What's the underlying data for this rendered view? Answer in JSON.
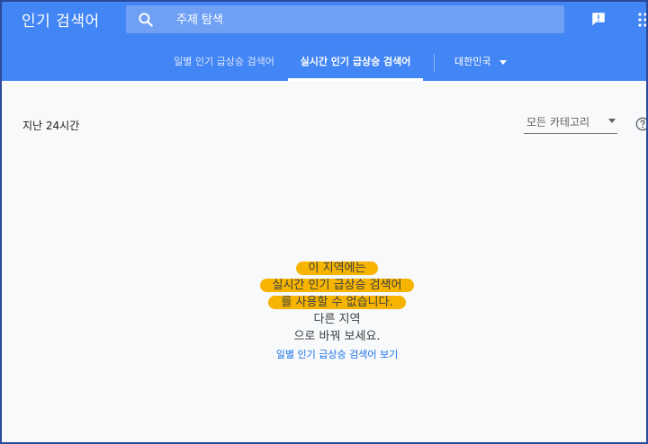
{
  "header": {
    "title": "인기 검색어",
    "search_placeholder": "주제 탐색"
  },
  "tabs": [
    {
      "label": "일별 인기 급상승 검색어"
    },
    {
      "label": "실시간 인기 급상승 검색어",
      "active": true
    }
  ],
  "country": {
    "label": "대한민국"
  },
  "filters": {
    "period": "지난 24시간",
    "category": "모든 카테고리"
  },
  "empty_state": {
    "lines": [
      "이 지역에는",
      "실시간 인기 급상승 검색어",
      "를 사용할 수 없습니다.",
      "다른 지역",
      "으로 바꿔 보세요."
    ],
    "link": "일별 인기 급상승 검색어 보기"
  },
  "colors": {
    "header_bg": "#4285f4",
    "highlight": "#f6b400",
    "link": "#1a73e8"
  }
}
